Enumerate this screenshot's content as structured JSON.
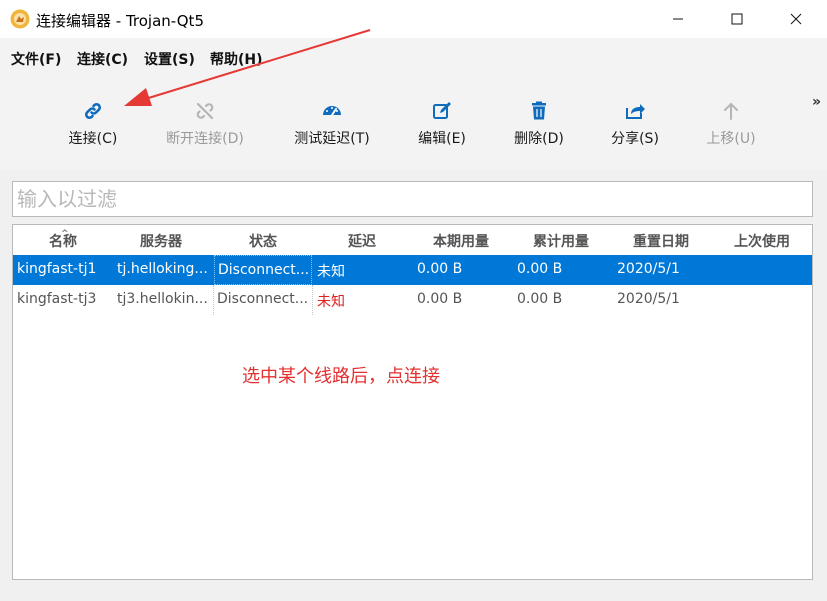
{
  "window": {
    "title": "连接编辑器 - Trojan-Qt5",
    "colors": {
      "accent": "#0078d7",
      "annotation": "#e33030",
      "arrow": "#e53935",
      "latency_unknown": "#e02020"
    }
  },
  "menubar": {
    "items": [
      {
        "label": "文件(F)"
      },
      {
        "label": "连接(C)"
      },
      {
        "label": "设置(S)"
      },
      {
        "label": "帮助(H)"
      }
    ]
  },
  "toolbar": {
    "more": "»",
    "buttons": [
      {
        "label": "连接(C)",
        "icon": "link-icon",
        "enabled": true
      },
      {
        "label": "断开连接(D)",
        "icon": "unlink-icon",
        "enabled": false
      },
      {
        "label": "测试延迟(T)",
        "icon": "speedometer-icon",
        "enabled": true
      },
      {
        "label": "编辑(E)",
        "icon": "edit-icon",
        "enabled": true
      },
      {
        "label": "删除(D)",
        "icon": "trash-icon",
        "enabled": true
      },
      {
        "label": "分享(S)",
        "icon": "share-icon",
        "enabled": true
      },
      {
        "label": "上移(U)",
        "icon": "arrow-up-icon",
        "enabled": false
      }
    ]
  },
  "filter": {
    "placeholder": "输入以过滤",
    "value": ""
  },
  "table": {
    "columns": [
      "名称",
      "服务器",
      "状态",
      "延迟",
      "本期用量",
      "累计用量",
      "重置日期",
      "上次使用"
    ],
    "rows": [
      {
        "name": "kingfast-tj1",
        "server": "tj.helloking...",
        "status": "Disconnect...",
        "latency": "未知",
        "period_usage": "0.00  B",
        "total_usage": "0.00  B",
        "reset_date": "2020/5/1",
        "last_used": "",
        "selected": true
      },
      {
        "name": "kingfast-tj3",
        "server": "tj3.hellokin...",
        "status": "Disconnect...",
        "latency": "未知",
        "period_usage": "0.00  B",
        "total_usage": "0.00  B",
        "reset_date": "2020/5/1",
        "last_used": "",
        "selected": false
      }
    ]
  },
  "annotation": {
    "text": "选中某个线路后，点连接"
  }
}
